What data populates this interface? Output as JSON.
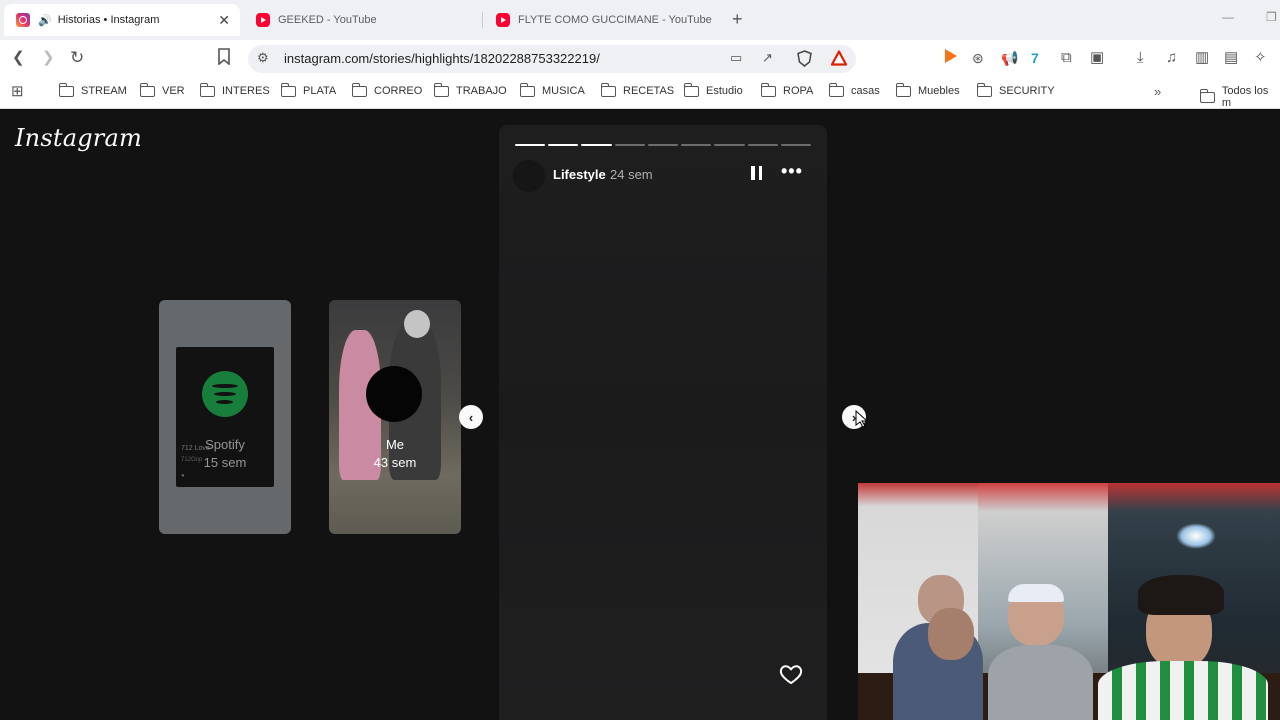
{
  "browser": {
    "tabs": [
      {
        "title": "Historias • Instagram",
        "active": true,
        "audio": true,
        "favicon": "instagram-icon"
      },
      {
        "title": "GEEKED - YouTube",
        "active": false,
        "favicon": "youtube-icon"
      },
      {
        "title": "FLYTE COMO GUCCIMANE - YouTube",
        "active": false,
        "favicon": "youtube-icon"
      }
    ],
    "url": "instagram.com/stories/highlights/18202288753322219/",
    "bookmarks": [
      "STREAM",
      "VER",
      "INTERES",
      "PLATA",
      "CORREO",
      "TRABAJO",
      "MUSICA",
      "RECETAS",
      "Estudio",
      "ROPA",
      "casas",
      "Muebles",
      "SECURITY"
    ],
    "all_bookmarks_label": "Todos los m",
    "colors": {
      "brave_accent": "#ff2000",
      "play_accent": "#f97316"
    }
  },
  "instagram": {
    "logo": "Instagram",
    "highlights": [
      {
        "title": "Spotify",
        "time": "15 sem",
        "cover_text_1": "712 Love",
        "cover_text_2": "712Oop"
      },
      {
        "title": "Me",
        "time": "43 sem"
      }
    ],
    "story": {
      "name": "Lifestyle",
      "time": "24 sem",
      "segments_total": 9,
      "segments_viewed": 3
    }
  }
}
